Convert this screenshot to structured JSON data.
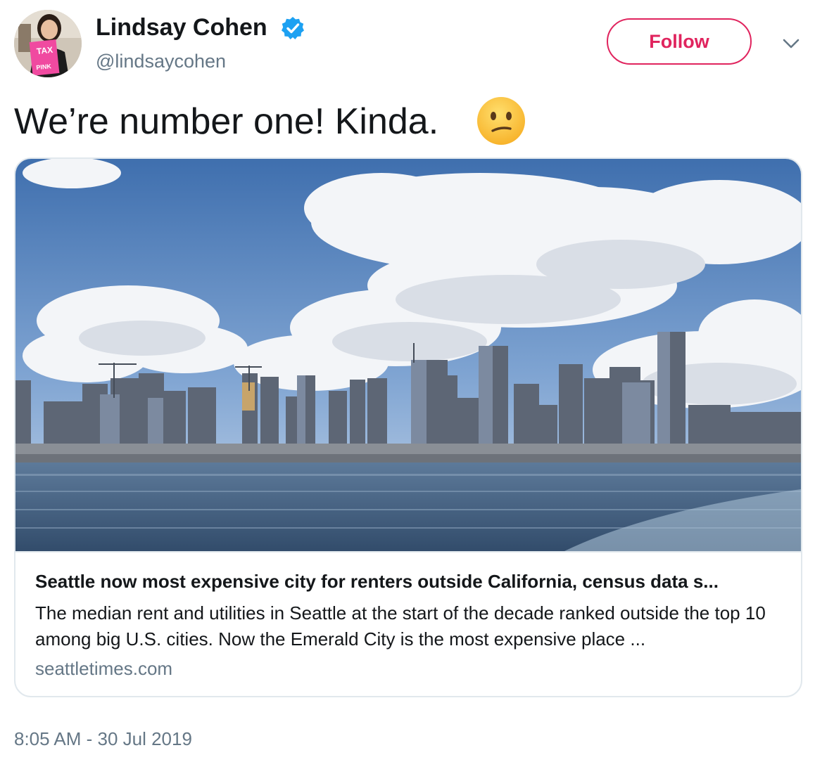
{
  "author": {
    "display_name": "Lindsay Cohen",
    "handle": "@lindsaycohen",
    "verified_icon": "verified-badge-icon",
    "avatar_sign_text": "PINK TAX"
  },
  "actions": {
    "follow_label": "Follow",
    "more_icon": "chevron-down-icon"
  },
  "tweet": {
    "text": "We’re number one! Kinda.",
    "emoji": "confused-face-icon",
    "timestamp": "8:05 AM - 30 Jul 2019"
  },
  "card": {
    "image": "seattle-skyline-photo",
    "title": "Seattle now most expensive city for renters outside California, census data s...",
    "description": "The median rent and utilities in Seattle at the start of the decade ranked outside the top 10 among big U.S. cities. Now the Emerald City is the most expensive place ...",
    "domain": "seattletimes.com"
  },
  "colors": {
    "follow_accent": "#e0245e",
    "verified_blue": "#1da1f2",
    "secondary_text": "#657786",
    "border": "#e1e8ed"
  }
}
